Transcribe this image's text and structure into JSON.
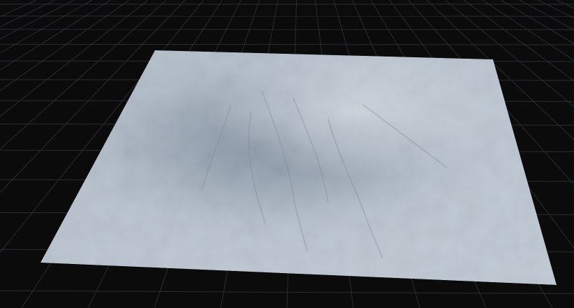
{
  "viewport": {
    "background_color": "#0b0b0c",
    "grid_line_color": "#2a2d31"
  },
  "terrain": {
    "base_color": "#bcc6d1",
    "shadow_color": "#56657a",
    "highlight_color": "#eef1f5"
  }
}
